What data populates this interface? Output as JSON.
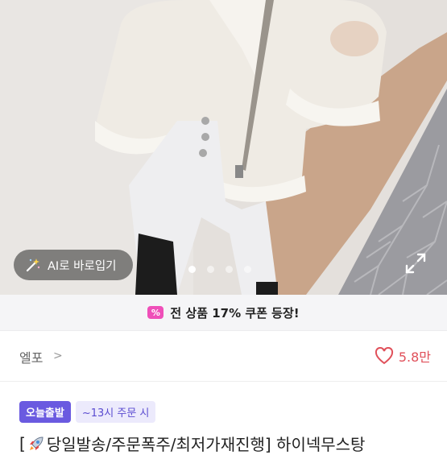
{
  "hero": {
    "ai_button_label": "AI로 바로입기",
    "carousel_total": 4,
    "carousel_active_index": 0
  },
  "coupon": {
    "icon_text": "%",
    "text": "전 상품 17% 쿠폰 등장!",
    "icon_color": "#ef4fb9"
  },
  "shop": {
    "name": "엘포",
    "chevron": ">",
    "like_count": "5.8만",
    "like_color": "#e0505a"
  },
  "product": {
    "badge_today": "오늘출발",
    "badge_time": "~13시 주문 시",
    "title_prefix": "[",
    "title_text": "당일발송/주문폭주/최저가재진행] 하이넥무스탕",
    "badge_color": "#6a5ae0"
  }
}
